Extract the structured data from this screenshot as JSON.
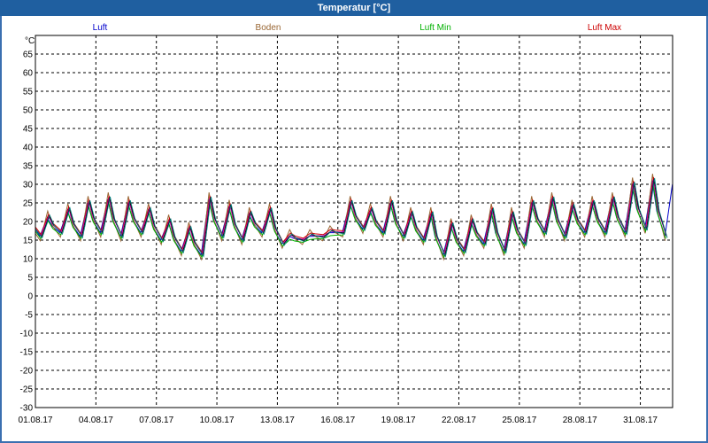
{
  "window": {
    "title": "Temperatur [°C]"
  },
  "chart_data": {
    "type": "line",
    "title": "Temperatur [°C]",
    "ylabel": "°C",
    "ylim": [
      -30,
      70
    ],
    "yticks": [
      65,
      60,
      55,
      50,
      45,
      40,
      35,
      30,
      25,
      20,
      15,
      10,
      5,
      0,
      -5,
      -10,
      -15,
      -20,
      -25,
      -30
    ],
    "xlim": [
      0,
      31.6
    ],
    "xticks": [
      {
        "x": 0,
        "label": "01.08.17"
      },
      {
        "x": 3,
        "label": "04.08.17"
      },
      {
        "x": 6,
        "label": "07.08.17"
      },
      {
        "x": 9,
        "label": "10.08.17"
      },
      {
        "x": 12,
        "label": "13.08.17"
      },
      {
        "x": 15,
        "label": "16.08.17"
      },
      {
        "x": 18,
        "label": "19.08.17"
      },
      {
        "x": 21,
        "label": "22.08.17"
      },
      {
        "x": 24,
        "label": "25.08.17"
      },
      {
        "x": 27,
        "label": "28.08.17"
      },
      {
        "x": 30,
        "label": "31.08.17"
      }
    ],
    "grid": true,
    "legend_position": "top",
    "daily_minmax": [
      [
        16,
        21
      ],
      [
        17,
        23
      ],
      [
        16,
        25
      ],
      [
        17,
        26
      ],
      [
        16,
        25
      ],
      [
        17,
        23
      ],
      [
        15,
        20
      ],
      [
        12,
        18
      ],
      [
        11,
        26
      ],
      [
        16,
        24
      ],
      [
        15,
        22
      ],
      [
        17,
        23
      ],
      [
        14,
        16
      ],
      [
        15,
        16
      ],
      [
        16,
        17
      ],
      [
        17,
        25
      ],
      [
        18,
        23
      ],
      [
        17,
        25
      ],
      [
        16,
        22
      ],
      [
        15,
        22
      ],
      [
        11,
        19
      ],
      [
        12,
        20
      ],
      [
        14,
        23
      ],
      [
        12,
        22
      ],
      [
        14,
        25
      ],
      [
        17,
        26
      ],
      [
        16,
        24
      ],
      [
        17,
        25
      ],
      [
        17,
        26
      ],
      [
        17,
        30
      ],
      [
        18,
        31
      ],
      [
        16,
        30
      ],
      [
        14,
        19
      ],
      [
        14,
        16
      ]
    ],
    "series": [
      {
        "name": "Luft",
        "color": "#0000cc",
        "offsetLow": 0,
        "offsetHigh": 0
      },
      {
        "name": "Boden",
        "color": "#996633",
        "offsetLow": -1.2,
        "offsetHigh": 1.8
      },
      {
        "name": "Luft Min",
        "color": "#00b000",
        "offsetLow": -0.6,
        "offsetHigh": -0.8
      },
      {
        "name": "Luft Max",
        "color": "#cc0000",
        "offsetLow": 0.5,
        "offsetHigh": 0.9
      }
    ],
    "extra_series_colors": [
      "#cc00cc",
      "#000000",
      "#008080"
    ]
  }
}
